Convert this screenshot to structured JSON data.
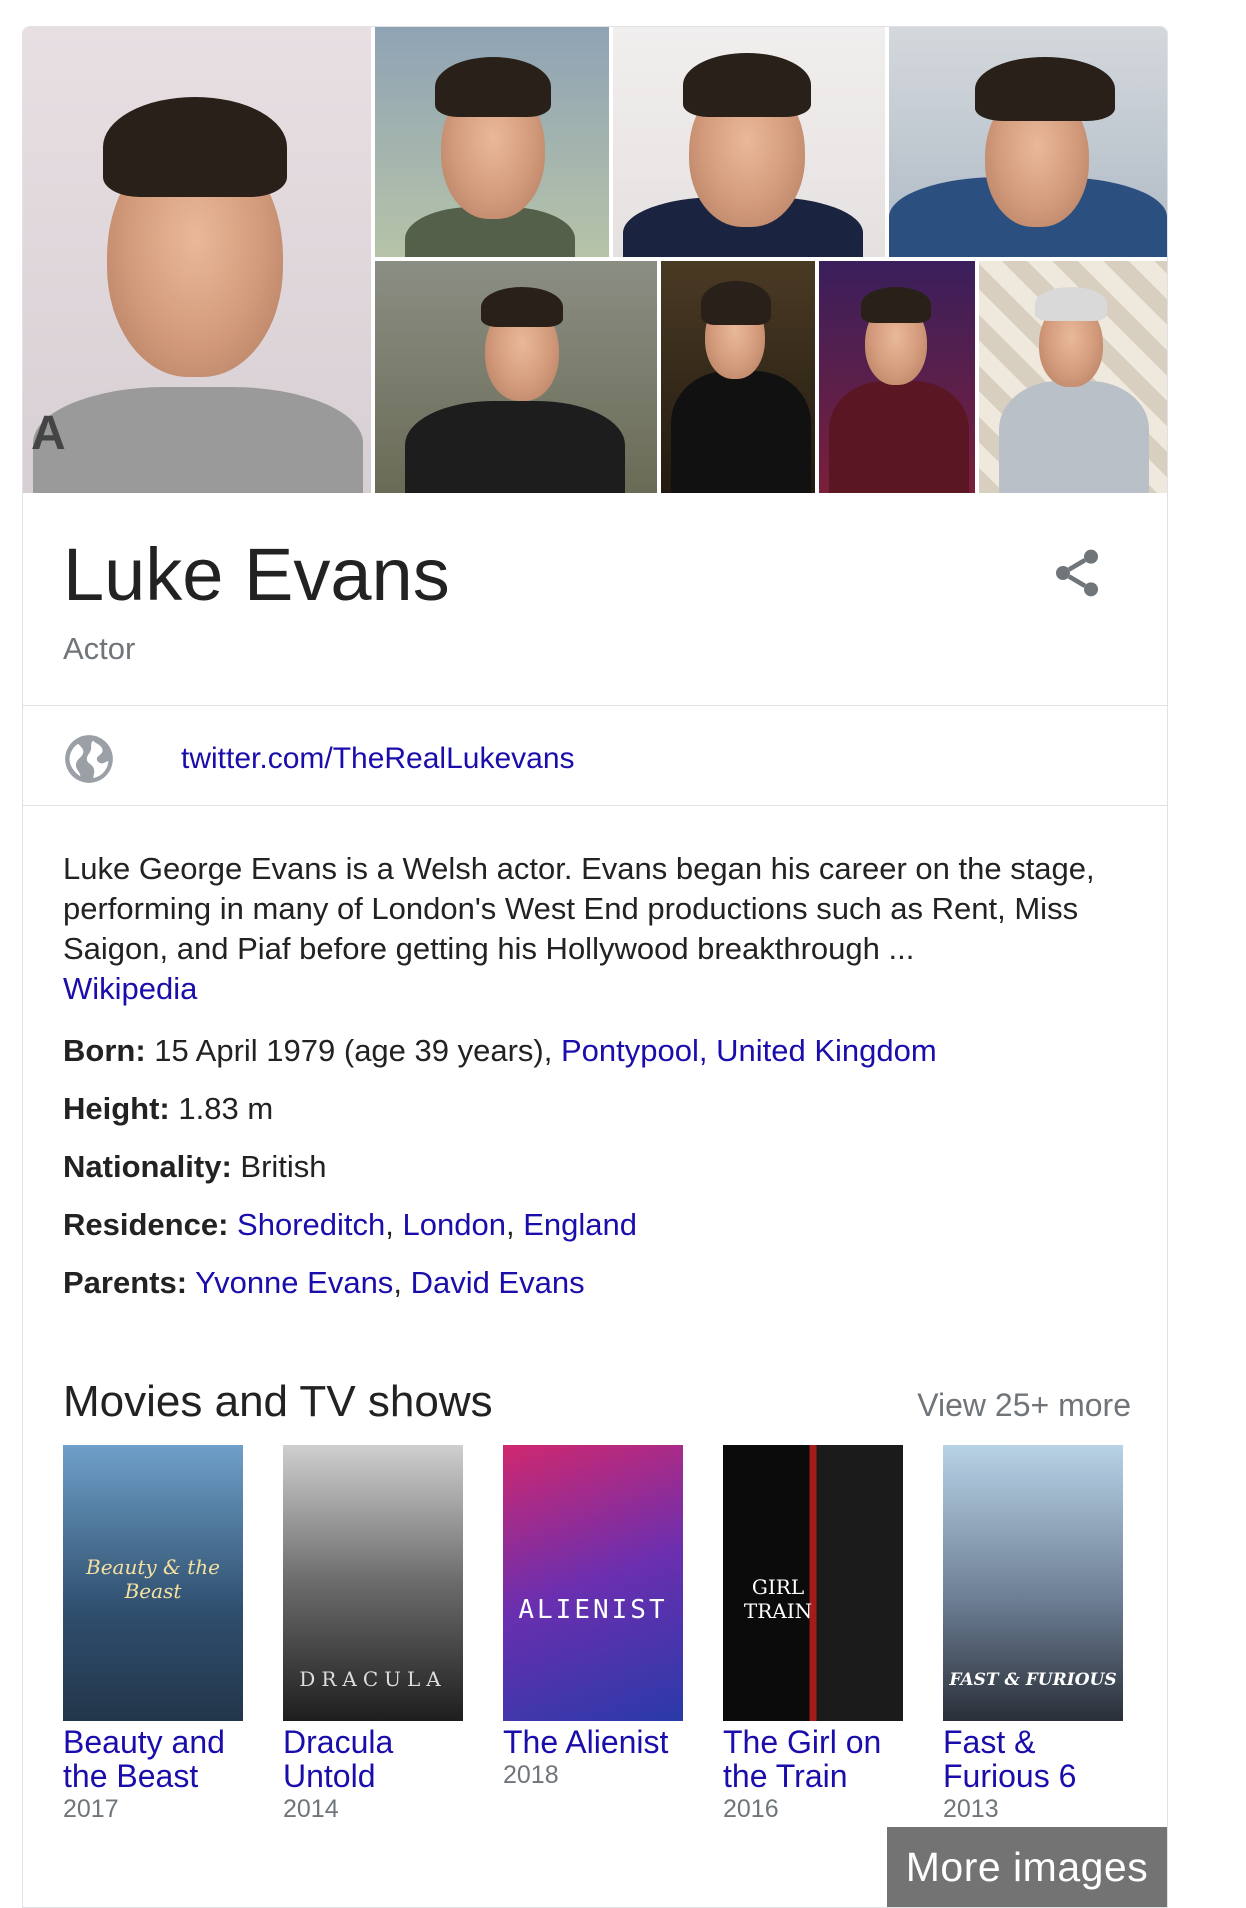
{
  "images": {
    "more_label": "More images",
    "main_photo_letter": "A"
  },
  "header": {
    "title": "Luke Evans",
    "subtitle": "Actor"
  },
  "website": {
    "label": "twitter.com/TheRealLukevans"
  },
  "description": {
    "text": "Luke George Evans is a Welsh actor. Evans began his career on the stage, performing in many of London's West End productions such as Rent, Miss Saigon, and Piaf before getting his Hollywood breakthrough ...",
    "source": "Wikipedia"
  },
  "facts": {
    "born": {
      "label": "Born:",
      "value": "15 April 1979 (age 39 years),",
      "place1": "Pontypool,",
      "place2": "United Kingdom"
    },
    "height": {
      "label": "Height:",
      "value": "1.83 m"
    },
    "nationality": {
      "label": "Nationality:",
      "value": "British"
    },
    "residence": {
      "label": "Residence:",
      "place1": "Shoreditch",
      "sep1": ",",
      "place2": "London",
      "sep2": ",",
      "place3": "England"
    },
    "parents": {
      "label": "Parents:",
      "parent1": "Yvonne Evans",
      "sep": ",",
      "parent2": "David Evans"
    }
  },
  "movies": {
    "section_title": "Movies and TV shows",
    "view_more": "View 25+ more",
    "items": [
      {
        "title_line1": "Beauty and",
        "title_line2": "the Beast",
        "year": "2017",
        "poster_text": "Beauty & the Beast"
      },
      {
        "title_line1": "Dracula",
        "title_line2": "Untold",
        "year": "2014",
        "poster_text": "DRACULA"
      },
      {
        "title_line1": "The Alienist",
        "title_line2": "",
        "year": "2018",
        "poster_text": "ALIENIST"
      },
      {
        "title_line1": "The Girl on",
        "title_line2": "the Train",
        "year": "2016",
        "poster_text": "GIRL TRAIN"
      },
      {
        "title_line1": "Fast &",
        "title_line2": "Furious 6",
        "year": "2013",
        "poster_text": "FAST & FURIOUS"
      }
    ]
  },
  "colors": {
    "link": "#1a0dab",
    "muted": "#70757a",
    "divider": "#dfe1e5"
  },
  "icons": {
    "share": "share-icon",
    "globe": "globe-icon"
  }
}
